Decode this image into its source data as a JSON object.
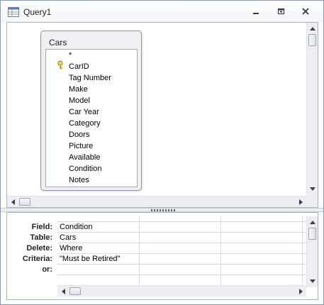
{
  "window": {
    "title": "Query1"
  },
  "table_box": {
    "title": "Cars",
    "fields": [
      "*",
      "CarID",
      "Tag Number",
      "Make",
      "Model",
      "Car Year",
      "Category",
      "Doors",
      "Picture",
      "Available",
      "Condition",
      "Notes"
    ],
    "primary_key_field": "CarID"
  },
  "grid": {
    "row_labels": [
      "Field:",
      "Table:",
      "Delete:",
      "Criteria:",
      "or:"
    ],
    "columns": [
      {
        "Field": "Condition",
        "Table": "Cars",
        "Delete": "Where",
        "Criteria": "\"Must be Retired\"",
        "or": ""
      },
      {
        "Field": "",
        "Table": "",
        "Delete": "",
        "Criteria": "",
        "or": ""
      },
      {
        "Field": "",
        "Table": "",
        "Delete": "",
        "Criteria": "",
        "or": ""
      }
    ]
  },
  "icons": {
    "app": "query-design-icon",
    "minimize": "minimize-icon",
    "restore": "restore-icon",
    "close": "close-icon",
    "key": "primary-key-icon"
  }
}
